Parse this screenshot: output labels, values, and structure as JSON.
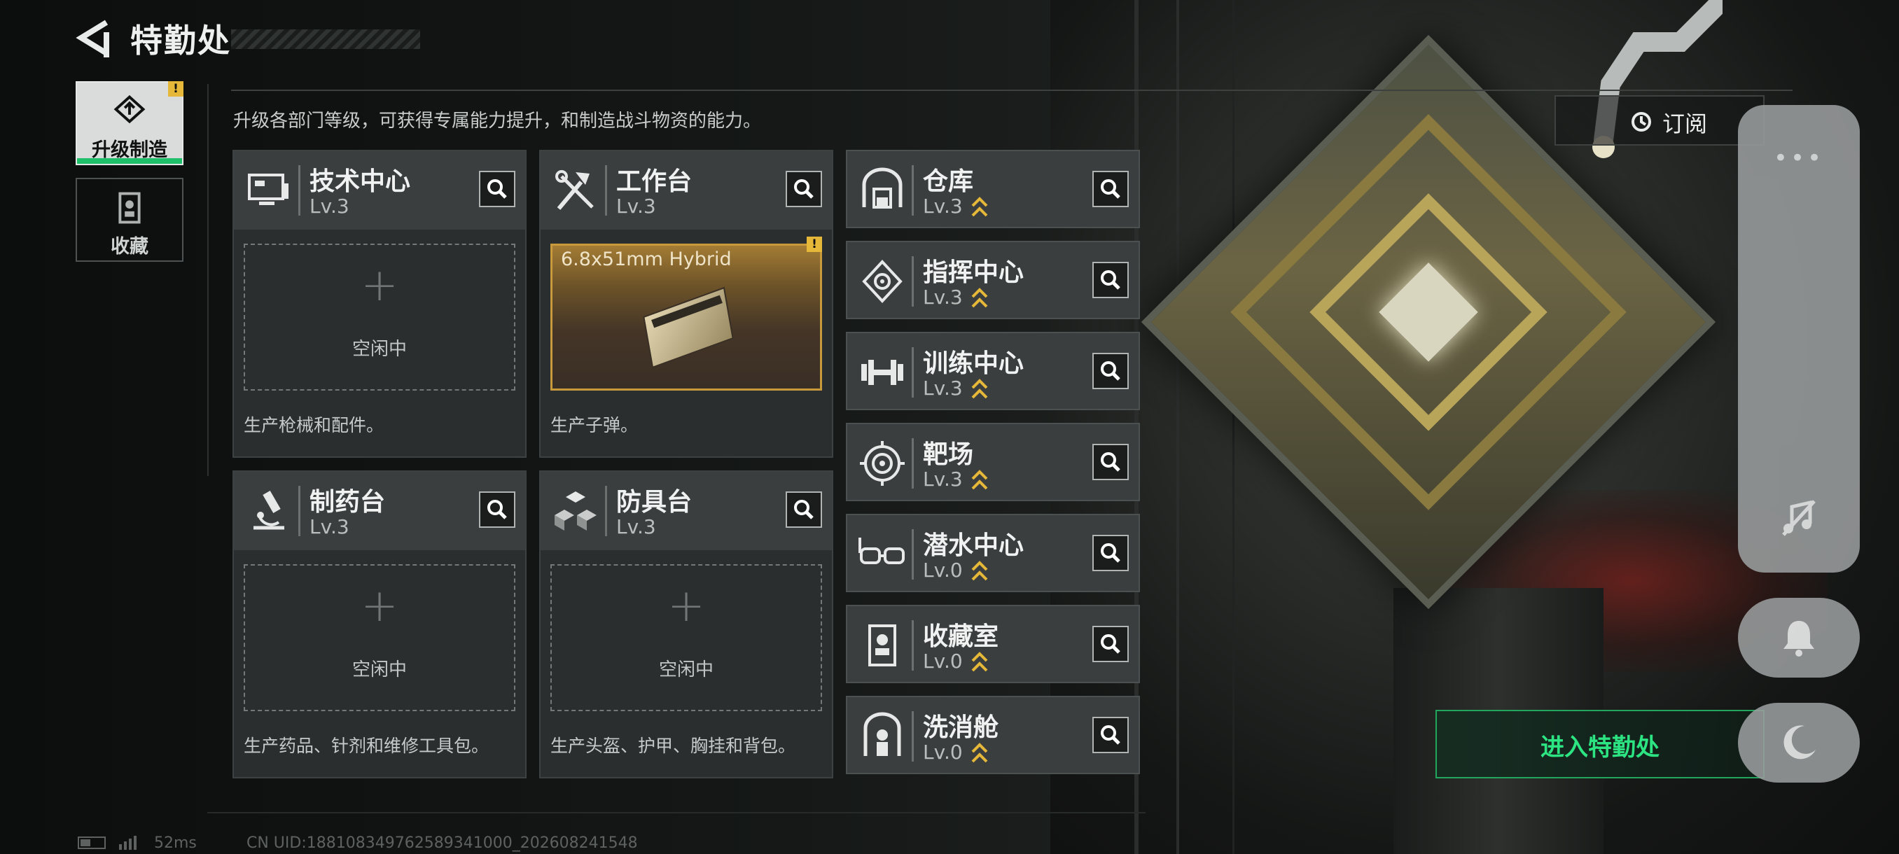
{
  "header": {
    "title": "特勤处",
    "description": "升级各部门等级，可获得专属能力提升，和制造战斗物资的能力。"
  },
  "tabs": [
    {
      "label": "升级制造",
      "icon": "upgrade-icon",
      "active": true,
      "badge": "!"
    },
    {
      "label": "收藏",
      "icon": "collection-icon",
      "active": false
    }
  ],
  "stations": [
    {
      "name": "技术中心",
      "level": "Lv.3",
      "icon": "monitor-icon",
      "slot_status": "空闲中",
      "slot_plus": "+",
      "footer": "生产枪械和配件。"
    },
    {
      "name": "工作台",
      "level": "Lv.3",
      "icon": "tools-icon",
      "product": "6.8x51mm Hybrid",
      "badge": "!",
      "footer": "生产子弹。"
    },
    {
      "name": "制药台",
      "level": "Lv.3",
      "icon": "microscope-icon",
      "slot_status": "空闲中",
      "slot_plus": "+",
      "footer": "生产药品、针剂和维修工具包。"
    },
    {
      "name": "防具台",
      "level": "Lv.3",
      "icon": "armor-blocks-icon",
      "slot_status": "空闲中",
      "slot_plus": "+",
      "footer": "生产头盔、护甲、胸挂和背包。"
    }
  ],
  "departments": [
    {
      "name": "仓库",
      "level": "Lv.3",
      "icon": "warehouse-icon"
    },
    {
      "name": "指挥中心",
      "level": "Lv.3",
      "icon": "command-icon"
    },
    {
      "name": "训练中心",
      "level": "Lv.3",
      "icon": "dumbbell-icon"
    },
    {
      "name": "靶场",
      "level": "Lv.3",
      "icon": "target-icon"
    },
    {
      "name": "潜水中心",
      "level": "Lv.0",
      "icon": "goggles-icon"
    },
    {
      "name": "收藏室",
      "level": "Lv.0",
      "icon": "display-case-icon"
    },
    {
      "name": "洗消舱",
      "level": "Lv.0",
      "icon": "decon-icon"
    }
  ],
  "subscribe_label": "订阅",
  "enter_button": "进入特勤处",
  "overlay": {
    "more": "•••"
  },
  "status_bar": {
    "ping": "52ms",
    "uid": "CN UID:188108349762589341000_202608241548"
  },
  "colors": {
    "accent_green": "#2de482",
    "upgrade_arrow": "#e6b83a",
    "product_gold": "#c99a3c"
  }
}
